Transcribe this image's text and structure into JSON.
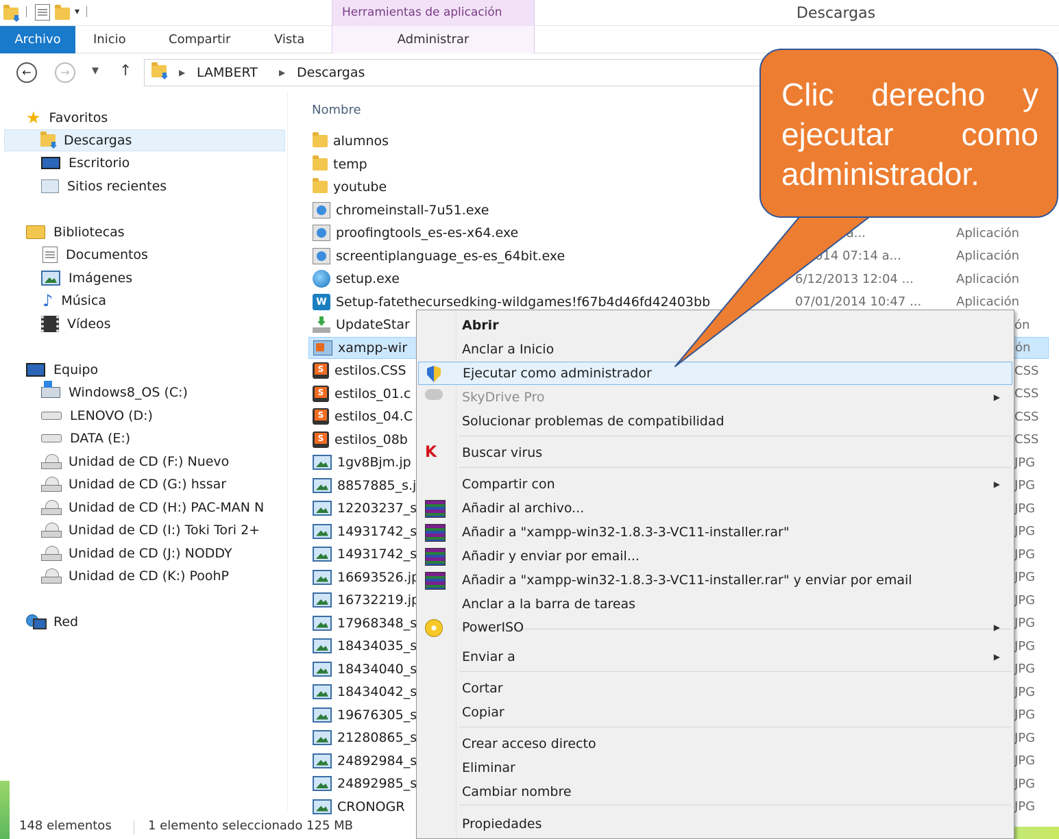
{
  "window": {
    "title": "Descargas",
    "contextual_group": "Herramientas de aplicación"
  },
  "ribbon": {
    "tabs": [
      "Archivo",
      "Inicio",
      "Compartir",
      "Vista",
      "Administrar"
    ]
  },
  "address": {
    "crumbs": [
      "LAMBERT",
      "Descargas"
    ]
  },
  "nav": {
    "favorites": {
      "label": "Favoritos",
      "items": [
        "Descargas",
        "Escritorio",
        "Sitios recientes"
      ]
    },
    "libraries": {
      "label": "Bibliotecas",
      "items": [
        "Documentos",
        "Imágenes",
        "Música",
        "Vídeos"
      ]
    },
    "computer": {
      "label": "Equipo",
      "items": [
        "Windows8_OS (C:)",
        "LENOVO (D:)",
        "DATA (E:)",
        "Unidad de CD (F:) Nuevo",
        "Unidad de CD (G:) hssar",
        "Unidad de CD (H:) PAC-MAN N",
        "Unidad de CD (I:) Toki Tori 2+",
        "Unidad de CD (J:) NODDY",
        "Unidad de CD (K:) PoohP"
      ]
    },
    "network": {
      "label": "Red"
    }
  },
  "files": {
    "column_name": "Nombre",
    "rows": [
      {
        "name": "alumnos",
        "icon": "folder-icon",
        "date": "",
        "type": ""
      },
      {
        "name": "temp",
        "icon": "folder-icon",
        "date": "",
        "type": ""
      },
      {
        "name": "youtube",
        "icon": "folder-icon",
        "date": "",
        "type": ""
      },
      {
        "name": "chromeinstall-7u51.exe",
        "icon": "installer-icon",
        "date": "",
        "type": ""
      },
      {
        "name": "proofingtools_es-es-x64.exe",
        "icon": "setup-icon",
        "date": "4 07:12 a...",
        "type": "Aplicación"
      },
      {
        "name": "screentiplanguage_es-es_64bit.exe",
        "icon": "setup-icon",
        "date": "2/2014 07:14 a...",
        "type": "Aplicación"
      },
      {
        "name": "setup.exe",
        "icon": "globe-setup-icon",
        "date": "6/12/2013 12:04 ...",
        "type": "Aplicación"
      },
      {
        "name": "Setup-fatethecursedking-wildgames!f67b4d46fd42403bb",
        "icon": "wildgames-icon",
        "date": "07/01/2014 10:47 ...",
        "type": "Aplicación"
      },
      {
        "name": "UpdateStar",
        "icon": "download-icon",
        "type_tail": "ón"
      },
      {
        "name": "xampp-wir",
        "icon": "xampp-icon",
        "type_tail": "ón",
        "selected": true
      },
      {
        "name": "estilos.CSS",
        "icon": "css-file-icon",
        "type_tail": "CSS"
      },
      {
        "name": "estilos_01.c",
        "icon": "css-file-icon",
        "type_tail": "CSS"
      },
      {
        "name": "estilos_04.C",
        "icon": "css-file-icon",
        "type_tail": "CSS"
      },
      {
        "name": "estilos_08b",
        "icon": "css-file-icon",
        "type_tail": "CSS"
      },
      {
        "name": "1gv8Bjm.jp",
        "icon": "image-file-icon",
        "type_tail": "JPG"
      },
      {
        "name": "8857885_s.j",
        "icon": "image-file-icon",
        "type_tail": "JPG"
      },
      {
        "name": "12203237_s",
        "icon": "image-file-icon",
        "type_tail": "JPG"
      },
      {
        "name": "14931742_s",
        "icon": "image-file-icon",
        "type_tail": "JPG"
      },
      {
        "name": "14931742_s",
        "icon": "image-file-icon",
        "type_tail": "JPG"
      },
      {
        "name": "16693526.jp",
        "icon": "image-file-icon",
        "type_tail": "JPG"
      },
      {
        "name": "16732219.jp",
        "icon": "image-file-icon",
        "type_tail": "JPG"
      },
      {
        "name": "17968348_s",
        "icon": "image-file-icon",
        "type_tail": "JPG"
      },
      {
        "name": "18434035_s",
        "icon": "image-file-icon",
        "type_tail": "JPG"
      },
      {
        "name": "18434040_s",
        "icon": "image-file-icon",
        "type_tail": "JPG"
      },
      {
        "name": "18434042_s",
        "icon": "image-file-icon",
        "type_tail": "JPG"
      },
      {
        "name": "19676305_s",
        "icon": "image-file-icon",
        "type_tail": "JPG"
      },
      {
        "name": "21280865_s",
        "icon": "image-file-icon",
        "type_tail": "JPG"
      },
      {
        "name": "24892984_s",
        "icon": "image-file-icon",
        "type_tail": "JPG"
      },
      {
        "name": "24892985_s",
        "icon": "image-file-icon",
        "type_tail": "JPG"
      },
      {
        "name": "CRONOGR",
        "icon": "image-file-icon",
        "type_tail": "JPG"
      }
    ]
  },
  "status": {
    "count": "148 elementos",
    "selection": "1 elemento seleccionado  125 MB"
  },
  "context_menu": {
    "items": [
      {
        "label": "Abrir",
        "bold": true
      },
      {
        "label": "Anclar a Inicio"
      },
      {
        "label": "Ejecutar como administrador",
        "icon": "uac-shield-icon",
        "highlighted": true
      },
      {
        "label": "SkyDrive Pro",
        "icon": "cloud-icon",
        "disabled": true,
        "submenu": true
      },
      {
        "label": "Solucionar problemas de compatibilidad"
      },
      {
        "label": "Buscar virus",
        "icon": "kaspersky-icon"
      },
      {
        "label": "Compartir con",
        "submenu": true
      },
      {
        "label": "Añadir al archivo...",
        "icon": "winrar-icon"
      },
      {
        "label": "Añadir a \"xampp-win32-1.8.3-3-VC11-installer.rar\"",
        "icon": "winrar-icon"
      },
      {
        "label": "Añadir y enviar por email...",
        "icon": "winrar-icon"
      },
      {
        "label": "Añadir a \"xampp-win32-1.8.3-3-VC11-installer.rar\" y enviar por email",
        "icon": "winrar-icon"
      },
      {
        "label": "Anclar a la barra de tareas"
      },
      {
        "label": "PowerISO",
        "icon": "poweriso-icon",
        "submenu": true
      },
      {
        "label": "Enviar a",
        "submenu": true
      },
      {
        "label": "Cortar"
      },
      {
        "label": "Copiar"
      },
      {
        "label": "Crear acceso directo"
      },
      {
        "label": "Eliminar"
      },
      {
        "label": "Cambiar nombre"
      },
      {
        "label": "Propiedades"
      }
    ]
  },
  "callout": {
    "text": "Clic derecho y ejecutar como administrador.",
    "fill": "#ed7d31",
    "border": "#2f5597"
  }
}
